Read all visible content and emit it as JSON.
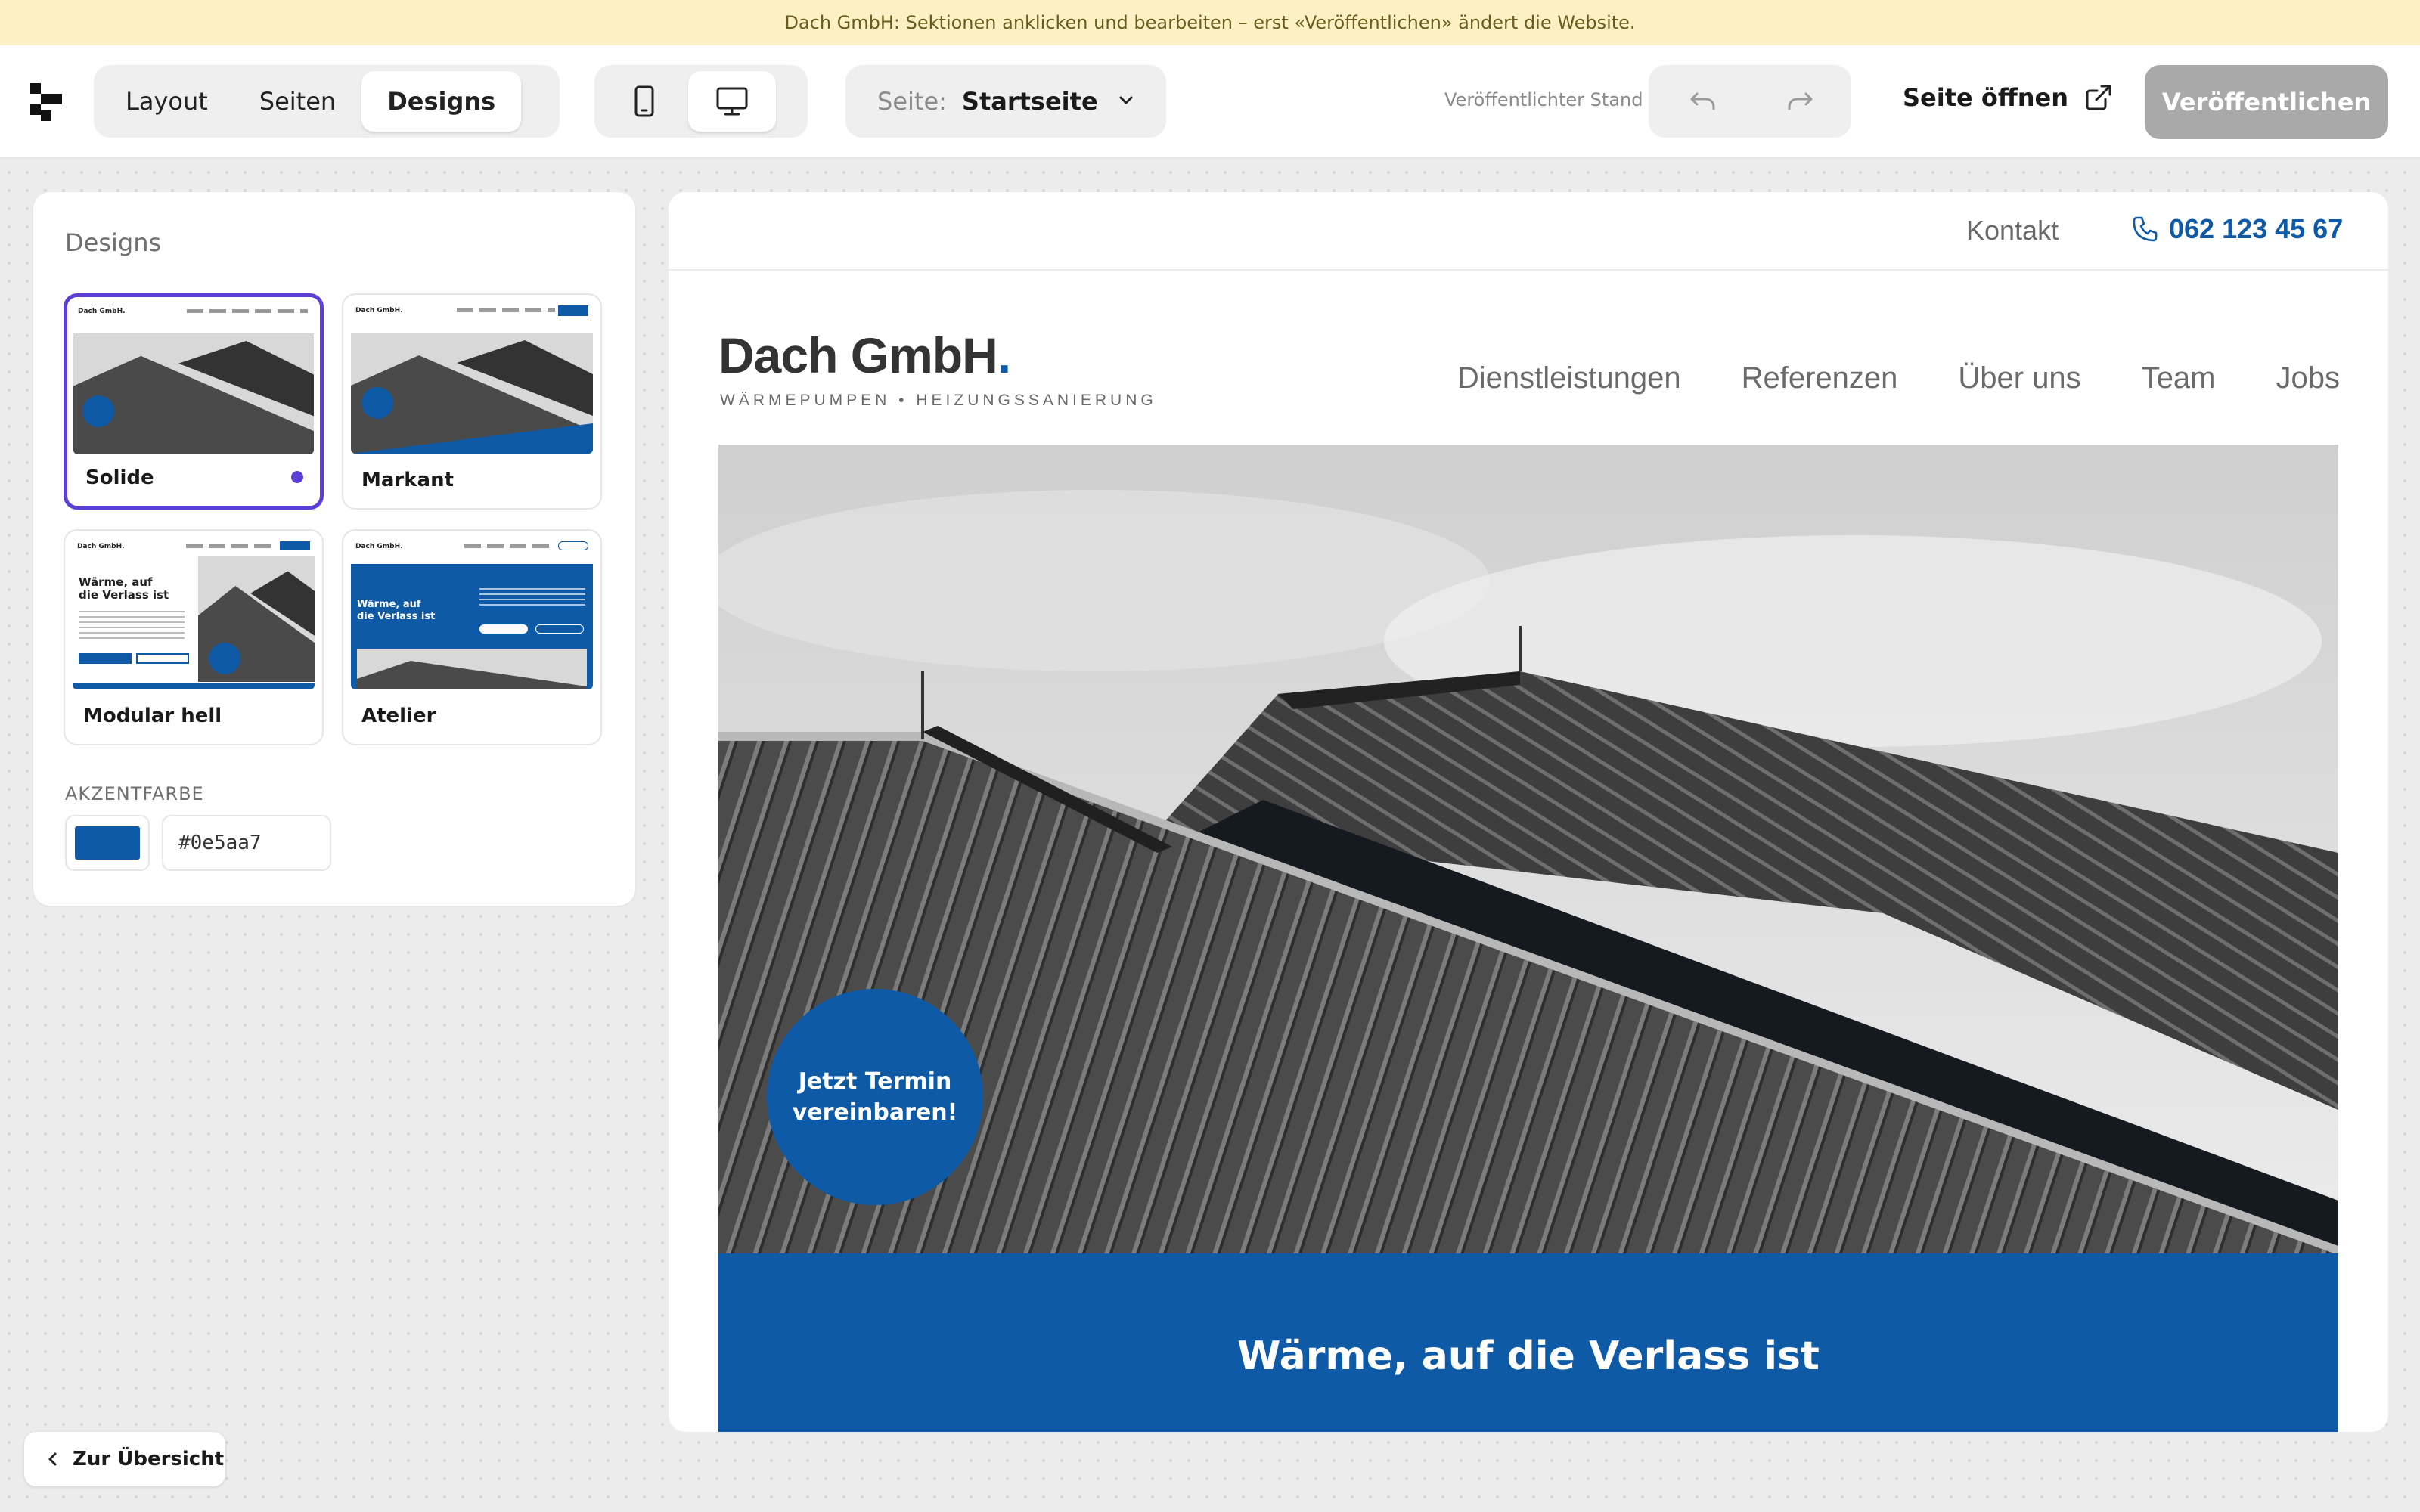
{
  "banner": {
    "text": "Dach GmbH: Sektionen anklicken und bearbeiten – erst «Veröffentlichen» ändert die Website."
  },
  "toolbar": {
    "tabs": [
      {
        "label": "Layout"
      },
      {
        "label": "Seiten"
      },
      {
        "label": "Designs",
        "active": true
      }
    ],
    "device": {
      "selected": "desktop"
    },
    "page_select": {
      "label": "Seite:",
      "value": "Startseite"
    },
    "published_state": "Veröffentlichter Stand",
    "open_site_label": "Seite öffnen",
    "publish_label": "Veröffentlichen"
  },
  "designs_panel": {
    "title": "Designs",
    "cards": [
      {
        "name": "Solide",
        "selected": true
      },
      {
        "name": "Markant"
      },
      {
        "name": "Modular hell"
      },
      {
        "name": "Atelier"
      }
    ],
    "accent_label": "AKZENTFARBE",
    "accent_value": "#0e5aa7"
  },
  "back_button": {
    "label": "Zur Übersicht"
  },
  "preview": {
    "topbar": {
      "contact": "Kontakt",
      "phone": "062 123 45 67"
    },
    "brand": {
      "name": "Dach GmbH",
      "dot": ".",
      "tagline": "WÄRMEPUMPEN • HEIZUNGSSANIERUNG"
    },
    "nav": [
      "Dienstleistungen",
      "Referenzen",
      "Über uns",
      "Team",
      "Jobs"
    ],
    "cta": "Jetzt Termin vereinbaren!",
    "headline": "Wärme, auf die Verlass ist"
  },
  "colors": {
    "accent": "#0e5aa7",
    "selection": "#5b3fd6",
    "banner": "#fcf1c4"
  }
}
